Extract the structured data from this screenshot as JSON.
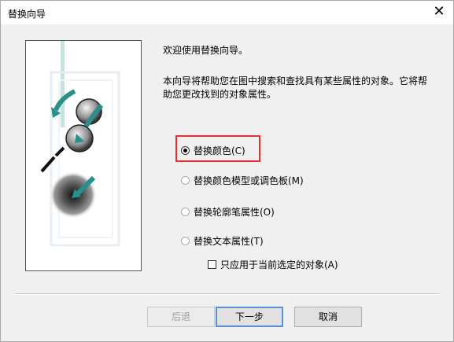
{
  "window": {
    "title": "替换向导",
    "close_icon": "close-icon"
  },
  "intro": {
    "welcome": "欢迎使用替换向导。",
    "description": "本向导将帮助您在图中搜索和查找具有某些属性的对象。它将帮助您更改找到的对象属性。"
  },
  "options": [
    {
      "label": "替换颜色(C)",
      "checked": true
    },
    {
      "label": "替换颜色模型或调色板(M)",
      "checked": false
    },
    {
      "label": "替换轮廓笔属性(O)",
      "checked": false
    },
    {
      "label": "替换文本属性(T)",
      "checked": false
    }
  ],
  "checkbox": {
    "label": "只应用于当前选定的对象(A)",
    "checked": false
  },
  "buttons": {
    "back": "后退",
    "next": "下一步",
    "cancel": "取消"
  },
  "colors": {
    "highlight": "#e53030",
    "accent": "#2a8f8a"
  }
}
